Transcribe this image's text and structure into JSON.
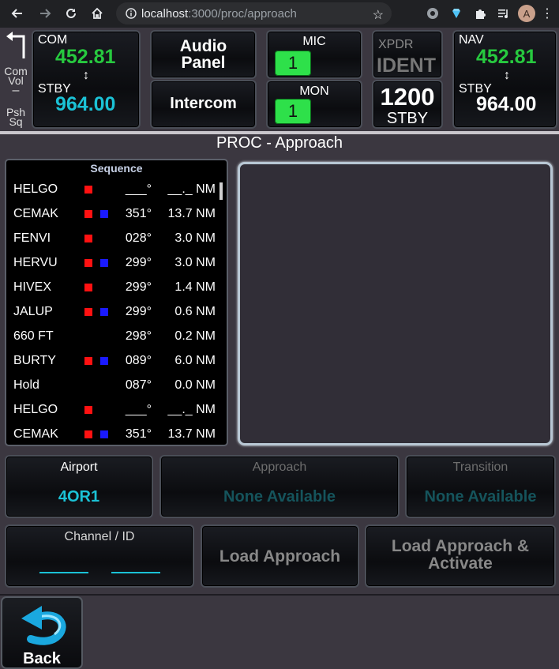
{
  "browser": {
    "url_host": "localhost",
    "url_path": ":3000/proc/approach",
    "avatar_letter": "A"
  },
  "radio": {
    "com": {
      "label": "COM",
      "active": "452.81",
      "stby_label": "STBY",
      "standby": "964.00"
    },
    "nav": {
      "label": "NAV",
      "active": "452.81",
      "stby_label": "STBY",
      "standby": "964.00"
    },
    "side": {
      "com_vol": "Com\nVol",
      "minus": "–",
      "psh_sq": "Psh\nSq"
    },
    "audio_panel": "Audio\nPanel",
    "intercom": "Intercom",
    "mic": {
      "label": "MIC",
      "value": "1"
    },
    "mon": {
      "label": "MON",
      "value": "1"
    },
    "xpdr": {
      "label": "XPDR",
      "ident": "IDENT",
      "code": "1200",
      "mode": "STBY"
    },
    "swap_symbol": "↕"
  },
  "page": {
    "title": "PROC - Approach"
  },
  "sequence": {
    "header": "Sequence",
    "rows": [
      {
        "name": "HELGO",
        "red": true,
        "blue": false,
        "course": "___°",
        "distance": "__._ NM"
      },
      {
        "name": "CEMAK",
        "red": true,
        "blue": true,
        "course": "351°",
        "distance": "13.7 NM"
      },
      {
        "name": "FENVI",
        "red": true,
        "blue": false,
        "course": "028°",
        "distance": "3.0 NM"
      },
      {
        "name": "HERVU",
        "red": true,
        "blue": true,
        "course": "299°",
        "distance": "3.0 NM"
      },
      {
        "name": "HIVEX",
        "red": true,
        "blue": false,
        "course": "299°",
        "distance": "1.4 NM"
      },
      {
        "name": "JALUP",
        "red": true,
        "blue": true,
        "course": "299°",
        "distance": "0.6 NM"
      },
      {
        "name": "660 FT",
        "red": false,
        "blue": false,
        "course": "298°",
        "distance": "0.2 NM"
      },
      {
        "name": "BURTY",
        "red": true,
        "blue": true,
        "course": "089°",
        "distance": "6.0 NM"
      },
      {
        "name": "Hold",
        "red": false,
        "blue": false,
        "course": "087°",
        "distance": "0.0 NM"
      },
      {
        "name": "HELGO",
        "red": true,
        "blue": false,
        "course": "___°",
        "distance": "__._ NM"
      },
      {
        "name": "CEMAK",
        "red": true,
        "blue": true,
        "course": "351°",
        "distance": "13.7 NM"
      }
    ]
  },
  "selectors": {
    "airport": {
      "label": "Airport",
      "value": "4OR1"
    },
    "approach": {
      "label": "Approach",
      "value": "None Available"
    },
    "transition": {
      "label": "Transition",
      "value": "None Available"
    }
  },
  "channel": {
    "label": "Channel / ID"
  },
  "buttons": {
    "load_approach": "Load Approach",
    "load_activate": "Load Approach &\nActivate",
    "back": "Back"
  },
  "colors": {
    "active_freq": "#27c93f",
    "standby_freq": "#1bc2d6",
    "waypoint_red": "#ff1111",
    "waypoint_blue": "#1a1aff",
    "disabled_text": "#15545c"
  }
}
